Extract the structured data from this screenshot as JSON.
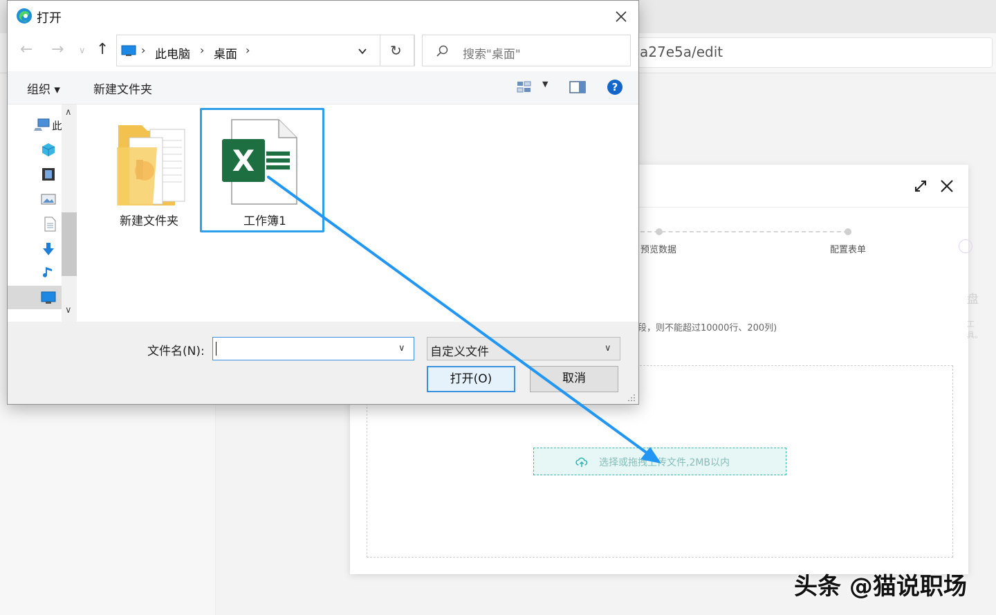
{
  "browser": {
    "url_fragment": "a27e5a/edit"
  },
  "web_modal": {
    "steps": [
      "预览数据",
      "配置表单"
    ],
    "side_text_1": "盘",
    "side_text_2": "工具。",
    "limit_text": "段，则不能超过10000行、200列)",
    "upload_text": "选择或拖拽上传文件,2MB以内",
    "upload_icon": "cloud-upload-icon",
    "icons": [
      "expand-icon",
      "close-icon"
    ]
  },
  "dialog": {
    "title": "打开",
    "app_icon": "edge-browser-icon",
    "breadcrumb": [
      "此电脑",
      "桌面"
    ],
    "search_placeholder": "搜索\"桌面\"",
    "commands": {
      "organize": "组织 ▾",
      "new_folder": "新建文件夹"
    },
    "nav_pane_label": "此",
    "files": [
      {
        "name": "新建文件夹",
        "type": "folder"
      },
      {
        "name": "工作簿1",
        "type": "excel"
      }
    ],
    "filename_label": "文件名(N):",
    "filename_value": "",
    "filetype": "自定义文件",
    "open_button": "打开(O)",
    "cancel_button": "取消",
    "colors": {
      "selection": "#2d9ee8",
      "excel_green": "#1d6f42",
      "arrow": "#2196f3",
      "upload_teal": "#39b7b0"
    }
  },
  "watermark": "头条 @猫说职场"
}
